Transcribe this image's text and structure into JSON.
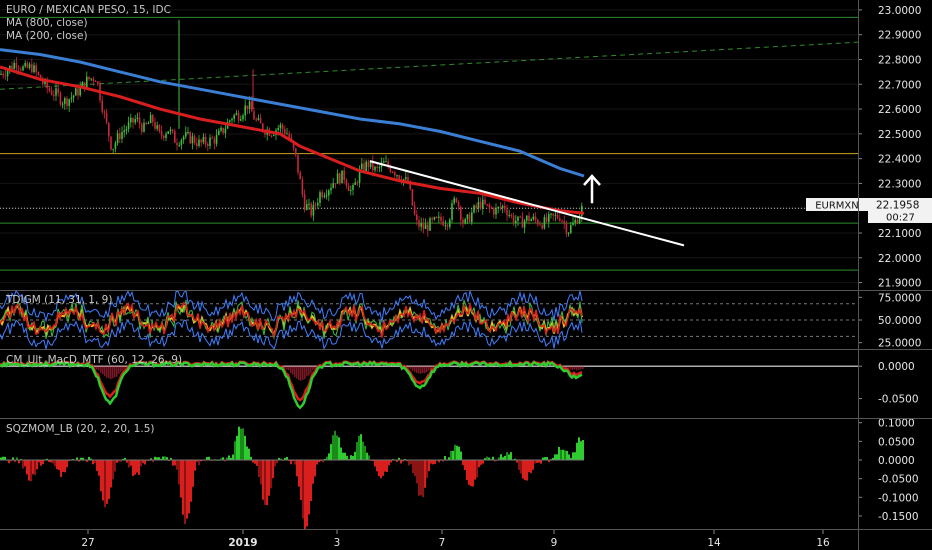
{
  "chart_data": [
    {
      "type": "candlestick",
      "title": "EURO / MEXICAN PESO, 15, IDC",
      "legend": [
        "MA (800, close)",
        "MA (200, close)"
      ],
      "symbol_badge": "EURMXN",
      "last_price": "22.1958",
      "countdown": "00:27",
      "x_ticks": [
        "27",
        "2019",
        "3",
        "7",
        "9",
        "14",
        "16"
      ],
      "y_ticks": [
        "23.0000",
        "22.9000",
        "22.8000",
        "22.7000",
        "22.6000",
        "22.5000",
        "22.4000",
        "22.3000",
        "22.2000",
        "22.1000",
        "22.0000",
        "21.9000"
      ],
      "ylim": [
        21.87,
        23.04
      ],
      "price_path": [
        [
          0,
          22.74
        ],
        [
          8,
          22.76
        ],
        [
          16,
          22.79
        ],
        [
          24,
          22.76
        ],
        [
          32,
          22.77
        ],
        [
          40,
          22.72
        ],
        [
          48,
          22.68
        ],
        [
          56,
          22.66
        ],
        [
          64,
          22.63
        ],
        [
          72,
          22.65
        ],
        [
          80,
          22.68
        ],
        [
          88,
          22.72
        ],
        [
          96,
          22.73
        ],
        [
          104,
          22.58
        ],
        [
          112,
          22.44
        ],
        [
          120,
          22.5
        ],
        [
          128,
          22.53
        ],
        [
          136,
          22.56
        ],
        [
          144,
          22.52
        ],
        [
          152,
          22.56
        ],
        [
          160,
          22.49
        ],
        [
          168,
          22.52
        ],
        [
          176,
          22.47
        ],
        [
          184,
          22.49
        ],
        [
          192,
          22.48
        ],
        [
          200,
          22.46
        ],
        [
          208,
          22.47
        ],
        [
          216,
          22.48
        ],
        [
          224,
          22.52
        ],
        [
          232,
          22.57
        ],
        [
          240,
          22.58
        ],
        [
          248,
          22.62
        ],
        [
          256,
          22.55
        ],
        [
          264,
          22.52
        ],
        [
          272,
          22.51
        ],
        [
          280,
          22.53
        ],
        [
          288,
          22.5
        ],
        [
          296,
          22.4
        ],
        [
          304,
          22.22
        ],
        [
          312,
          22.18
        ],
        [
          320,
          22.26
        ],
        [
          328,
          22.28
        ],
        [
          336,
          22.32
        ],
        [
          344,
          22.33
        ],
        [
          352,
          22.26
        ],
        [
          360,
          22.35
        ],
        [
          368,
          22.38
        ],
        [
          376,
          22.35
        ],
        [
          384,
          22.38
        ],
        [
          392,
          22.36
        ],
        [
          400,
          22.33
        ],
        [
          408,
          22.3
        ],
        [
          416,
          22.14
        ],
        [
          424,
          22.12
        ],
        [
          432,
          22.14
        ],
        [
          440,
          22.15
        ],
        [
          448,
          22.15
        ],
        [
          456,
          22.25
        ],
        [
          464,
          22.13
        ],
        [
          472,
          22.18
        ],
        [
          480,
          22.22
        ],
        [
          488,
          22.2
        ],
        [
          496,
          22.19
        ],
        [
          504,
          22.21
        ],
        [
          512,
          22.16
        ],
        [
          520,
          22.14
        ],
        [
          528,
          22.16
        ],
        [
          536,
          22.15
        ],
        [
          544,
          22.14
        ],
        [
          552,
          22.16
        ],
        [
          560,
          22.17
        ],
        [
          568,
          22.11
        ],
        [
          576,
          22.15
        ],
        [
          582,
          22.2
        ]
      ],
      "ma_800_path": [
        [
          0,
          22.84
        ],
        [
          40,
          22.82
        ],
        [
          80,
          22.79
        ],
        [
          120,
          22.75
        ],
        [
          160,
          22.71
        ],
        [
          200,
          22.68
        ],
        [
          240,
          22.65
        ],
        [
          280,
          22.62
        ],
        [
          320,
          22.59
        ],
        [
          360,
          22.56
        ],
        [
          400,
          22.54
        ],
        [
          440,
          22.51
        ],
        [
          480,
          22.47
        ],
        [
          520,
          22.43
        ],
        [
          560,
          22.36
        ],
        [
          584,
          22.33
        ]
      ],
      "ma_200_path": [
        [
          0,
          22.77
        ],
        [
          40,
          22.72
        ],
        [
          80,
          22.69
        ],
        [
          120,
          22.65
        ],
        [
          160,
          22.6
        ],
        [
          200,
          22.56
        ],
        [
          240,
          22.53
        ],
        [
          280,
          22.5
        ],
        [
          300,
          22.45
        ],
        [
          330,
          22.4
        ],
        [
          360,
          22.35
        ],
        [
          400,
          22.31
        ],
        [
          440,
          22.28
        ],
        [
          480,
          22.26
        ],
        [
          520,
          22.22
        ],
        [
          560,
          22.19
        ],
        [
          584,
          22.18
        ]
      ],
      "hlines_yellow": [
        22.42
      ],
      "hlines_green": [
        22.97,
        22.14,
        21.95
      ],
      "dotted_level": 22.2,
      "trendline": [
        [
          370,
          22.39
        ],
        [
          684,
          22.05
        ]
      ],
      "dashed_channel": [
        [
          0,
          22.68
        ],
        [
          858,
          22.87
        ]
      ],
      "arrow": {
        "x": 592,
        "from": 22.22,
        "to": 22.33
      }
    },
    {
      "type": "line",
      "title": "TDIGM (11, 31, 1, 9)",
      "y_ticks": [
        "75.0000",
        "50.0000",
        "25.0000"
      ],
      "ylim": [
        18,
        82
      ],
      "levels": [
        68,
        50,
        32
      ]
    },
    {
      "type": "line",
      "title": "CM_Ult_MacD_MTF (60, 12, 26, 9)",
      "y_ticks": [
        "0.0000",
        "-0.0500"
      ],
      "ylim": [
        -0.08,
        0.025
      ],
      "zero_line": 0
    },
    {
      "type": "area",
      "title": "SQZMOM_LB (20, 2, 20, 1.5)",
      "y_ticks": [
        "0.1000",
        "0.0500",
        "0.0000",
        "-0.0500",
        "-0.1000",
        "-0.1500"
      ],
      "ylim": [
        -0.185,
        0.11
      ]
    }
  ]
}
